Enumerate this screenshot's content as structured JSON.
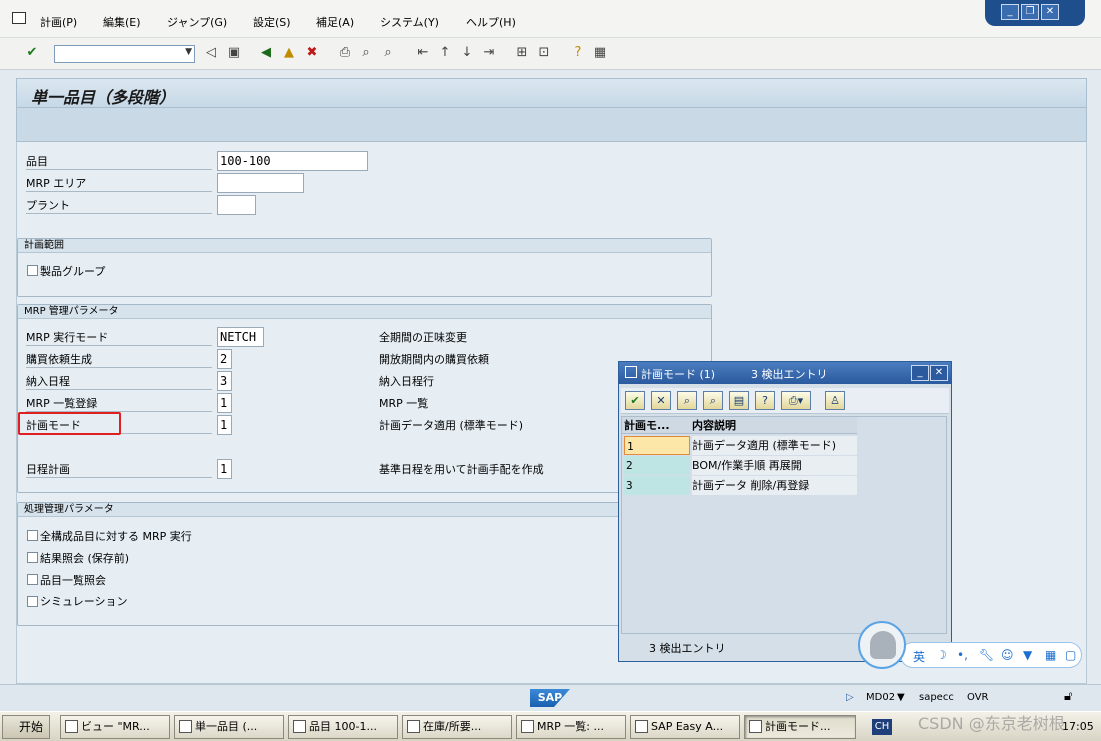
{
  "menubar": {
    "items": [
      {
        "label": "計画(P)"
      },
      {
        "label": "編集(E)"
      },
      {
        "label": "ジャンプ(G)"
      },
      {
        "label": "設定(S)"
      },
      {
        "label": "補足(A)"
      },
      {
        "label": "システム(Y)"
      },
      {
        "label": "ヘルプ(H)"
      }
    ]
  },
  "page": {
    "title": "単一品目（多段階）"
  },
  "header_fields": [
    {
      "label": "品目",
      "value": "100-100"
    },
    {
      "label": "MRP エリア",
      "value": ""
    },
    {
      "label": "プラント",
      "value": ""
    }
  ],
  "planning_scope": {
    "title": "計画範囲",
    "product_group_label": "製品グループ"
  },
  "mrp_params": {
    "title": "MRP 管理パラメータ",
    "rows": [
      {
        "label": "MRP 実行モード",
        "value": "NETCH",
        "desc": "全期間の正味変更"
      },
      {
        "label": "購買依頼生成",
        "value": "2",
        "desc": "開放期間内の購買依頼"
      },
      {
        "label": "納入日程",
        "value": "3",
        "desc": "納入日程行"
      },
      {
        "label": "MRP 一覧登録",
        "value": "1",
        "desc": "MRP 一覧"
      },
      {
        "label": "計画モード",
        "value": "1",
        "desc": "計画データ適用 (標準モード)"
      }
    ],
    "schedule": {
      "label": "日程計画",
      "value": "1",
      "desc": "基準日程を用いて計画手配を作成"
    }
  },
  "process_params": {
    "title": "処理管理パラメータ",
    "checks": [
      {
        "label": "全構成品目に対する MRP 実行"
      },
      {
        "label": "結果照会 (保存前)"
      },
      {
        "label": "品目一覧照会"
      },
      {
        "label": "シミュレーション"
      }
    ]
  },
  "popup": {
    "title": "計画モード (1)",
    "count": "3 検出エントリ",
    "col_key": "計画モ...",
    "col_desc": "内容説明",
    "rows": [
      {
        "key": "1",
        "desc": "計画データ適用 (標準モード)"
      },
      {
        "key": "2",
        "desc": "BOM/作業手順 再展開"
      },
      {
        "key": "3",
        "desc": "計画データ 削除/再登録"
      }
    ],
    "status": "3 検出エントリ"
  },
  "statusbar": {
    "logo": "SAP",
    "tcode": "MD02",
    "system": "sapecc",
    "mode": "OVR"
  },
  "taskbar": {
    "start": "开始",
    "tasks": [
      {
        "label": "ビュー \"MR..."
      },
      {
        "label": "単一品目 (..."
      },
      {
        "label": "品目 100-1..."
      },
      {
        "label": "在庫/所要..."
      },
      {
        "label": "MRP 一覧: ..."
      },
      {
        "label": "SAP Easy A..."
      },
      {
        "label": "計画モード..."
      }
    ],
    "ime_lang": "CH",
    "time": "17:05"
  },
  "ime_bar": {
    "label": "英"
  },
  "watermark": "CSDN @东京老树根"
}
